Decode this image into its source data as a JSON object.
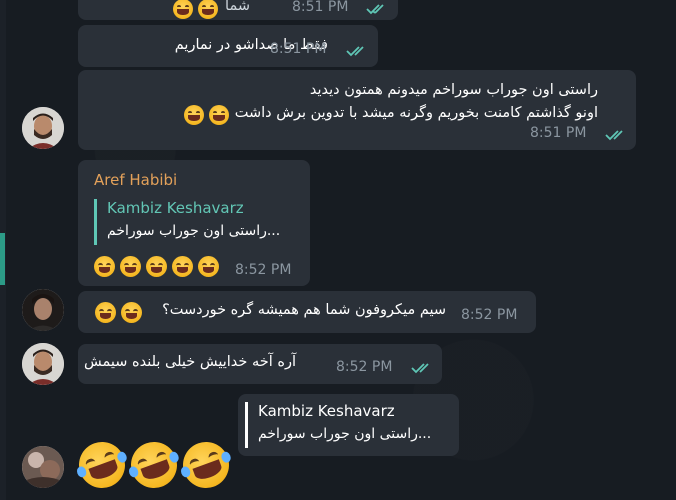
{
  "colors": {
    "bubble": "#2a3038",
    "time": "#8b96a0",
    "check": "#5fc7b6",
    "sender": "#e3a15a",
    "reply_name": "#62c6b5"
  },
  "messages": [
    {
      "id": "m0",
      "text": "شما ",
      "time": "8:51 PM",
      "read": true,
      "partial": true
    },
    {
      "id": "m1",
      "text": "فقط ما صداشو در نماریم",
      "time": "8:51 PM",
      "read": true
    },
    {
      "id": "m2",
      "lines": [
        "راستی اون جوراب سوراخم میدونم همتون دیدید",
        "اونو گذاشتم کامنت بخوریم وگرنه میشد با تدوین برش داشت"
      ],
      "time": "8:51 PM",
      "read": true,
      "emoji_count": 2
    },
    {
      "id": "m3",
      "sender": "Aref Habibi",
      "reply_to": {
        "name": "Kambiz Keshavarz",
        "text": "...راستی اون جوراب سوراخم"
      },
      "time": "8:52 PM",
      "emoji_count": 5
    },
    {
      "id": "m4",
      "text": "سیم میکروفون شما هم همیشه گره خوردست؟",
      "time": "8:52 PM",
      "emoji_count": 2
    },
    {
      "id": "m5",
      "text": "آره آخه خداییش خیلی بلنده سیمش",
      "time": "8:52 PM",
      "read": true
    },
    {
      "id": "m6",
      "reply_to": {
        "name": "Kambiz Keshavarz",
        "text": "...راستی اون جوراب سوراخم"
      }
    },
    {
      "id": "m7",
      "emoji_count": 3
    }
  ],
  "avatars": [
    {
      "name": "avatar-kambiz"
    },
    {
      "name": "avatar-aref"
    },
    {
      "name": "avatar-kambiz"
    },
    {
      "name": "avatar-other"
    }
  ]
}
